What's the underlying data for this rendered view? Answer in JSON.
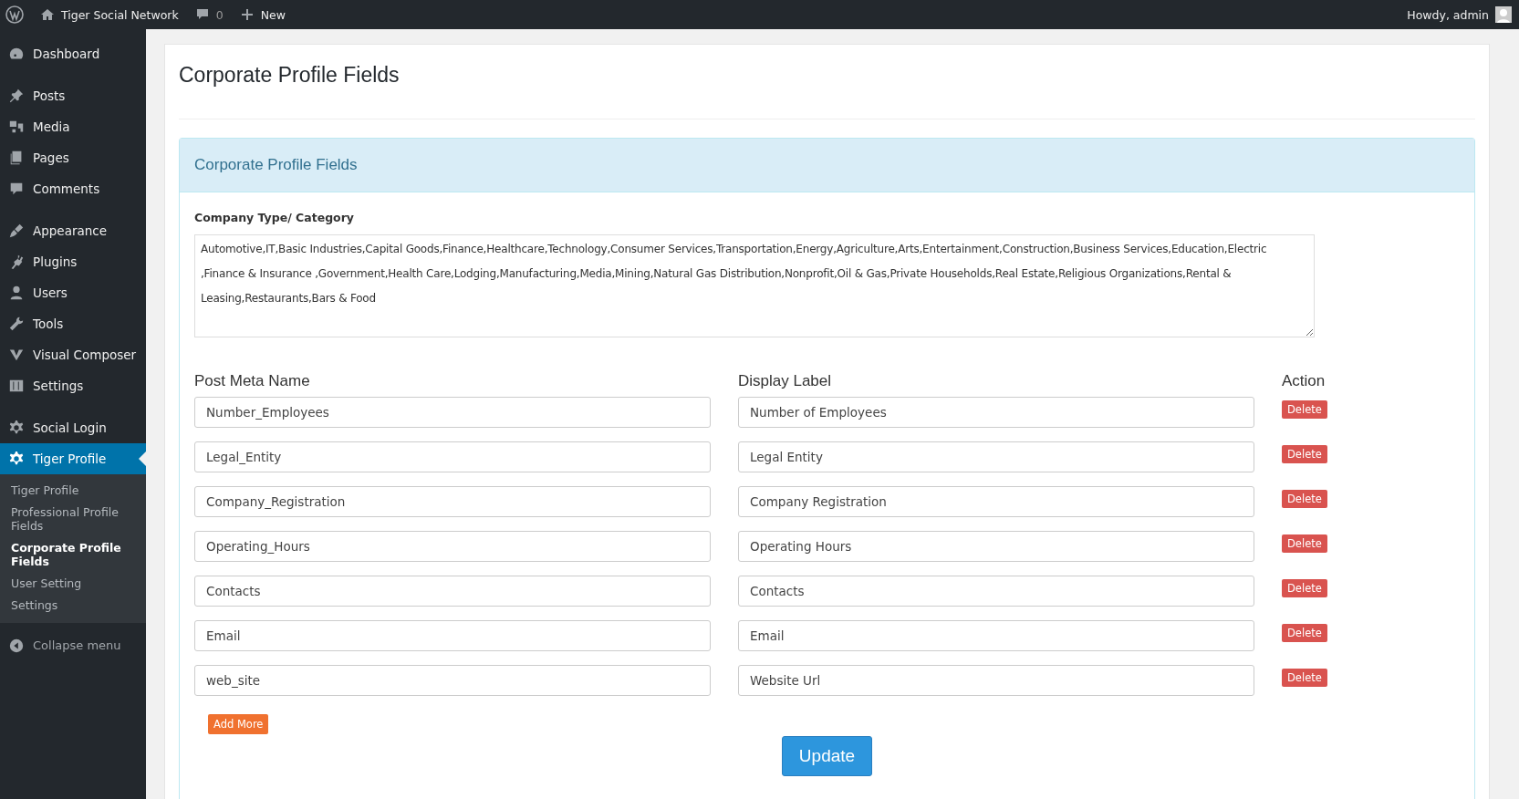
{
  "admin_bar": {
    "site": "Tiger Social Network",
    "comments": "0",
    "new": "New",
    "greeting": "Howdy, admin"
  },
  "menu": [
    [
      {
        "label": "Dashboard",
        "kind": "dashboard",
        "selected": false
      }
    ],
    [
      {
        "label": "Posts",
        "kind": "pin",
        "selected": false
      },
      {
        "label": "Media",
        "kind": "media",
        "selected": false
      },
      {
        "label": "Pages",
        "kind": "pages",
        "selected": false
      },
      {
        "label": "Comments",
        "kind": "comment",
        "selected": false
      }
    ],
    [
      {
        "label": "Appearance",
        "kind": "brush",
        "selected": false
      },
      {
        "label": "Plugins",
        "kind": "plug",
        "selected": false
      },
      {
        "label": "Users",
        "kind": "user",
        "selected": false
      },
      {
        "label": "Tools",
        "kind": "wrench",
        "selected": false
      },
      {
        "label": "Visual Composer",
        "kind": "vc",
        "selected": false
      },
      {
        "label": "Settings",
        "kind": "sliders",
        "selected": false
      }
    ],
    [
      {
        "label": "Social Login",
        "kind": "gear",
        "selected": false
      },
      {
        "label": "Tiger Profile",
        "kind": "gear",
        "selected": true
      }
    ]
  ],
  "submenu": [
    {
      "label": "Tiger Profile",
      "selected": false
    },
    {
      "label": "Professional Profile Fields",
      "selected": false
    },
    {
      "label": "Corporate Profile Fields",
      "selected": true
    },
    {
      "label": "User Setting",
      "selected": false
    },
    {
      "label": "Settings",
      "selected": false
    }
  ],
  "collapse": "Collapse menu",
  "page_title": "Corporate Profile Fields",
  "panel": {
    "heading": "Corporate Profile Fields",
    "category_label": "Company Type/ Category",
    "category_value": "Automotive,IT,Basic Industries,Capital Goods,Finance,Healthcare,Technology,Consumer Services,Transportation,Energy,Agriculture,Arts,Entertainment,Construction,Business Services,Education,Electric ,Finance & Insurance ,Government,Health Care,Lodging,Manufacturing,Media,Mining,Natural Gas Distribution,Nonprofit,Oil & Gas,Private Households,Real Estate,Religious Organizations,Rental & Leasing,Restaurants,Bars & Food",
    "columns": [
      "Post Meta Name",
      "Display Label",
      "Action"
    ],
    "rows": [
      {
        "meta": "Number_Employees",
        "label": "Number of Employees",
        "action": "Delete"
      },
      {
        "meta": "Legal_Entity",
        "label": "Legal Entity",
        "action": "Delete"
      },
      {
        "meta": "Company_Registration",
        "label": "Company Registration",
        "action": "Delete"
      },
      {
        "meta": "Operating_Hours",
        "label": "Operating Hours",
        "action": "Delete"
      },
      {
        "meta": "Contacts",
        "label": "Contacts",
        "action": "Delete"
      },
      {
        "meta": "Email",
        "label": "Email",
        "action": "Delete"
      },
      {
        "meta": "web_site",
        "label": "Website Url",
        "action": "Delete"
      }
    ],
    "add_more": "Add More",
    "update": "Update"
  }
}
